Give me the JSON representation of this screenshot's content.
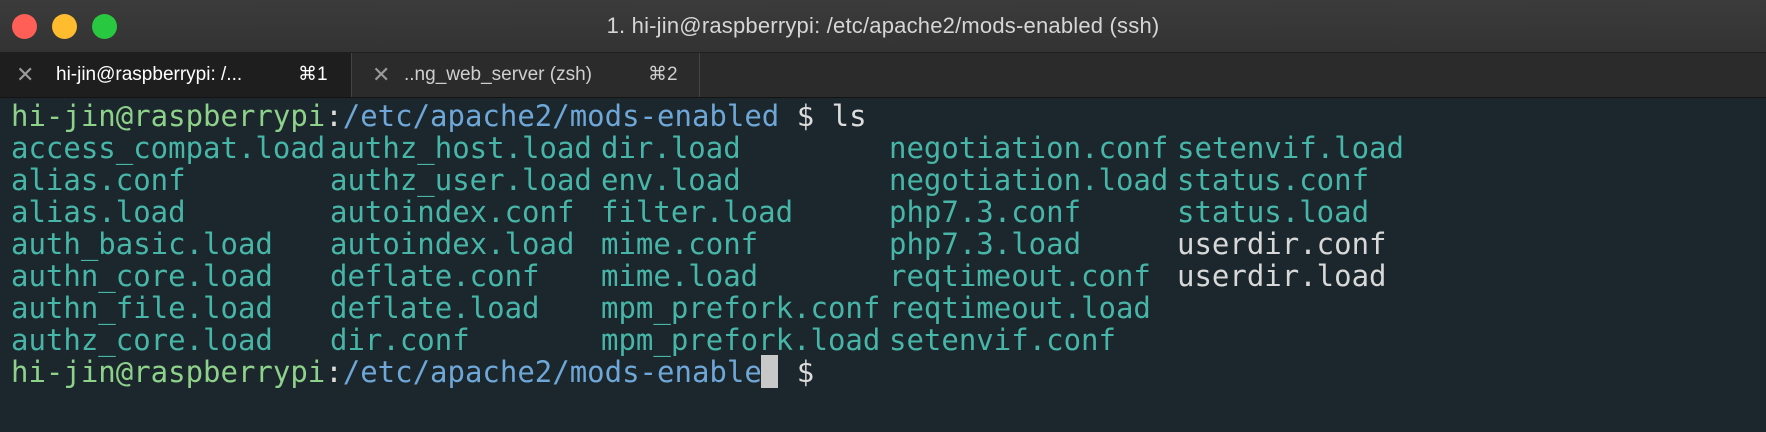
{
  "window": {
    "title": "1. hi-jin@raspberrypi: /etc/apache2/mods-enabled (ssh)"
  },
  "tabs": [
    {
      "close": "✕",
      "label": "hi-jin@raspberrypi: /...",
      "shortcut": "⌘1",
      "active": true
    },
    {
      "close": "✕",
      "label": "..ng_web_server (zsh)",
      "shortcut": "⌘2",
      "active": false
    }
  ],
  "terminal": {
    "prompt_user": "hi-jin@raspberrypi",
    "prompt_sep": ":",
    "prompt_path": "/etc/apache2/mods-enabled",
    "prompt_symbol": " $ ",
    "command": "ls",
    "columns": [
      [
        "access_compat.load",
        "alias.conf",
        "alias.load",
        "auth_basic.load",
        "authn_core.load",
        "authn_file.load",
        "authz_core.load"
      ],
      [
        "authz_host.load",
        "authz_user.load",
        "autoindex.conf",
        "autoindex.load",
        "deflate.conf",
        "deflate.load",
        "dir.conf"
      ],
      [
        "dir.load",
        "env.load",
        "filter.load",
        "mime.conf",
        "mime.load",
        "mpm_prefork.conf",
        "mpm_prefork.load"
      ],
      [
        "negotiation.conf",
        "negotiation.load",
        "php7.3.conf",
        "php7.3.load",
        "reqtimeout.conf",
        "reqtimeout.load",
        "setenvif.conf"
      ],
      [
        "setenvif.load",
        "status.conf",
        "status.load",
        "userdir.conf",
        "userdir.load"
      ]
    ],
    "colors": {
      "background": "#1b272c",
      "user": "#8ed18a",
      "path": "#6ea7d8",
      "symlink": "#47b6a8",
      "plain_file": "#d8d8d8"
    }
  }
}
